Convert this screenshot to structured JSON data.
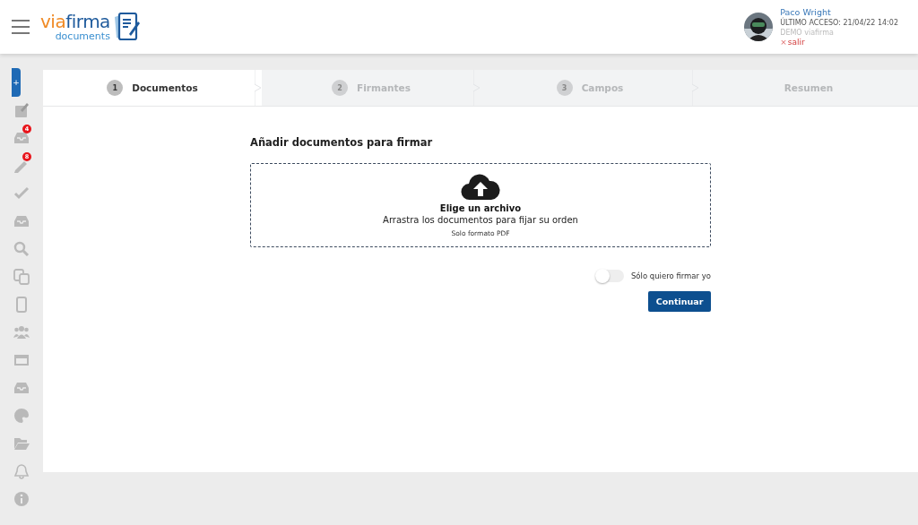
{
  "header": {
    "logo": {
      "prefix": "via",
      "name": "firma",
      "subtitle": "documents"
    },
    "user": {
      "name": "Paco Wright",
      "last_access": "ÚLTIMO ACCESO: 21/04/22 14:02",
      "organization": "DEMO viafirma",
      "logout_icon": "×",
      "logout": "salir"
    }
  },
  "sidebar": {
    "items": [
      {
        "kind": "new",
        "label": "+"
      },
      {
        "kind": "sign"
      },
      {
        "kind": "inbox",
        "badge": "4"
      },
      {
        "kind": "pencil",
        "badge": "8"
      },
      {
        "kind": "check"
      },
      {
        "kind": "tray"
      },
      {
        "kind": "search"
      },
      {
        "kind": "copy"
      },
      {
        "kind": "phone"
      },
      {
        "kind": "users"
      },
      {
        "kind": "window"
      },
      {
        "kind": "tray"
      },
      {
        "kind": "palette"
      },
      {
        "kind": "folder"
      },
      {
        "kind": "bell"
      },
      {
        "kind": "info"
      }
    ]
  },
  "steps": [
    {
      "number": "1",
      "label": "Documentos",
      "selected": true
    },
    {
      "number": "2",
      "label": "Firmantes",
      "selected": false
    },
    {
      "number": "3",
      "label": "Campos",
      "selected": false
    },
    {
      "label": "Resumen",
      "selected": false
    }
  ],
  "upload": {
    "title": "Añadir documentos para firmar",
    "action": "Elige un archivo",
    "hint": "Arrastra los documentos para fijar su orden",
    "format": "Solo formato PDF"
  },
  "only_me": {
    "label": "Sólo quiero firmar yo",
    "on": false
  },
  "continue_button": "Continuar"
}
